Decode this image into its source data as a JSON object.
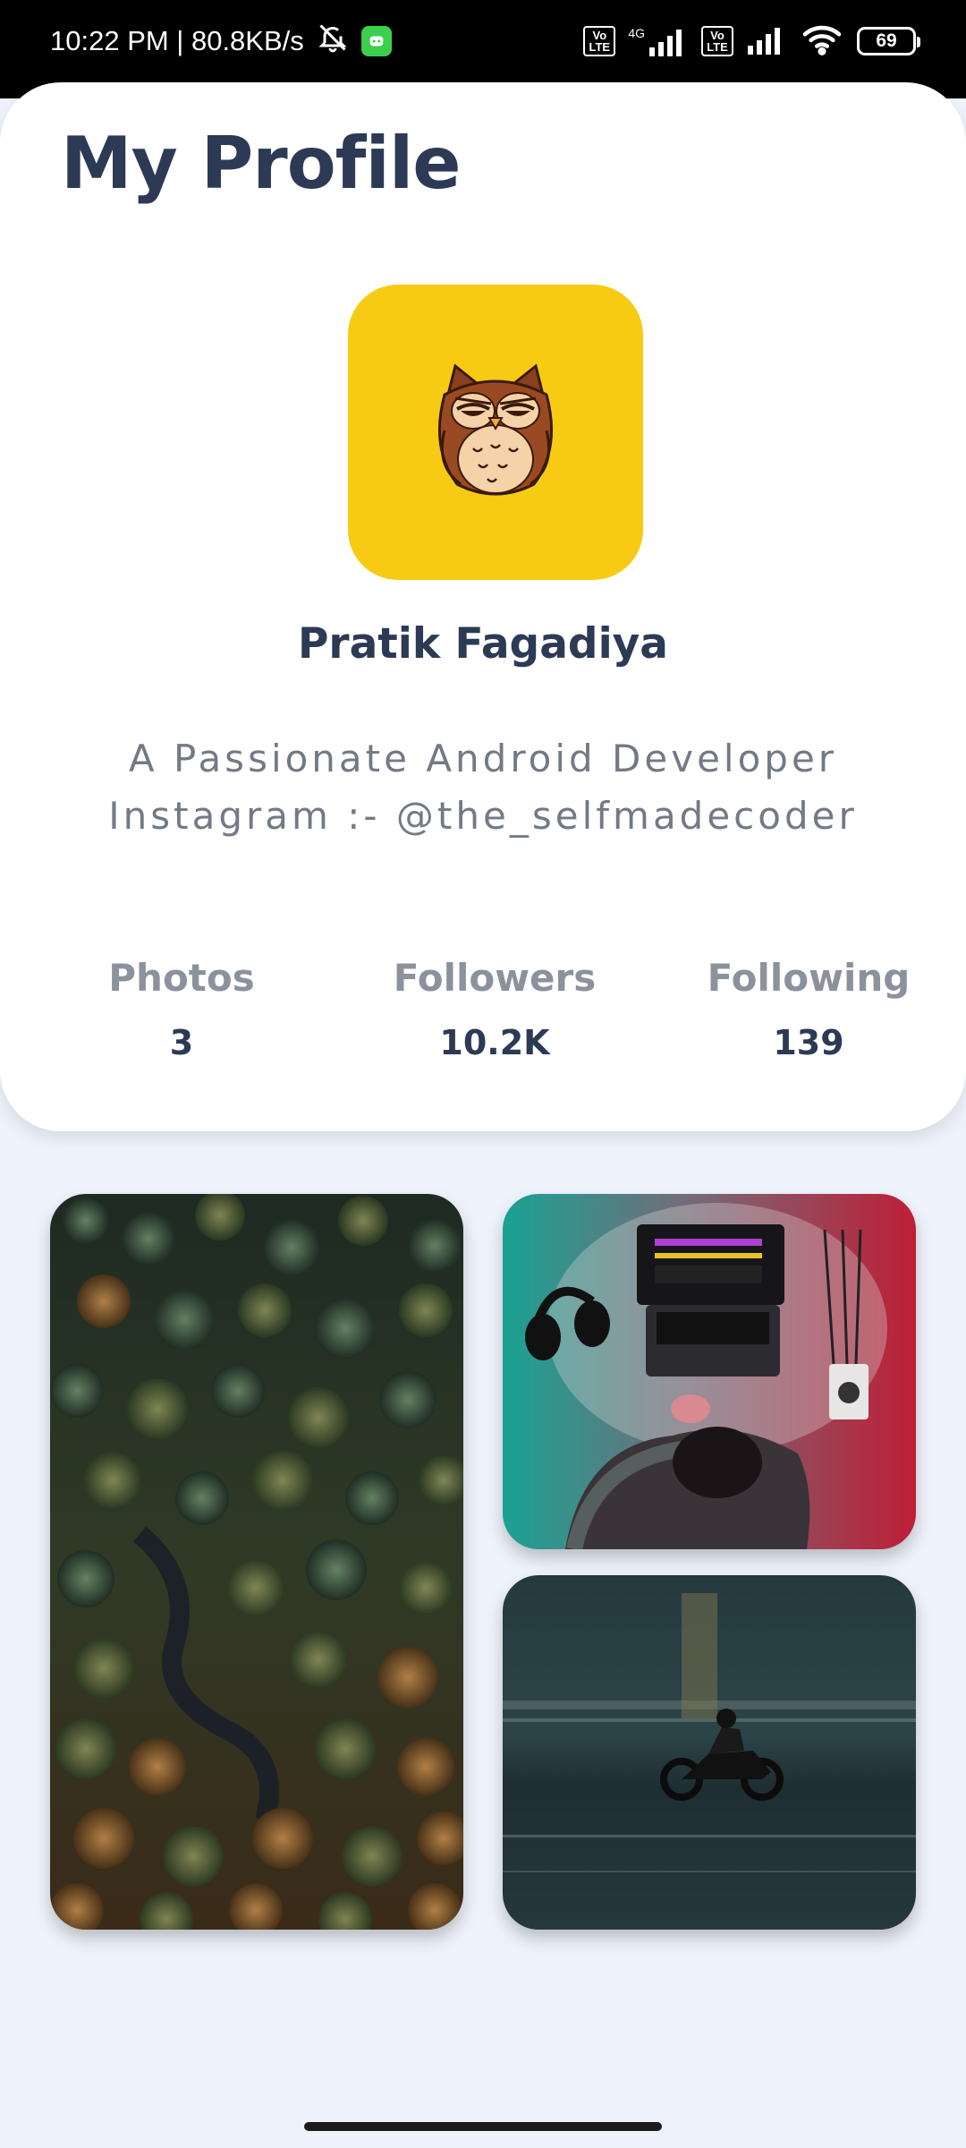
{
  "status_bar": {
    "time_speed": "10:22 PM | 80.8KB/s",
    "network_4g": "4G",
    "volte_1": "Vo\nLTE",
    "volte_2": "Vo\nLTE",
    "battery": "69"
  },
  "header": {
    "title": "My Profile"
  },
  "profile": {
    "avatar_icon": "owl-icon",
    "avatar_bg": "#f7cb13",
    "name": "Pratik Fagadiya",
    "bio_line1": "A Passionate Android Developer",
    "bio_line2": "Instagram :- @the_selfmadecoder"
  },
  "stats": [
    {
      "label": "Photos",
      "value": "3"
    },
    {
      "label": "Followers",
      "value": "10.2K"
    },
    {
      "label": "Following",
      "value": "139"
    }
  ],
  "photos": [
    {
      "subject": "aerial-forest-photo"
    },
    {
      "subject": "desk-laptop-headphones-photo"
    },
    {
      "subject": "motorcycle-rider-photo"
    }
  ],
  "colors": {
    "title_text": "#2d3a55",
    "muted_text": "#737a86",
    "page_background": "#eef3fb",
    "card_background": "#ffffff"
  }
}
